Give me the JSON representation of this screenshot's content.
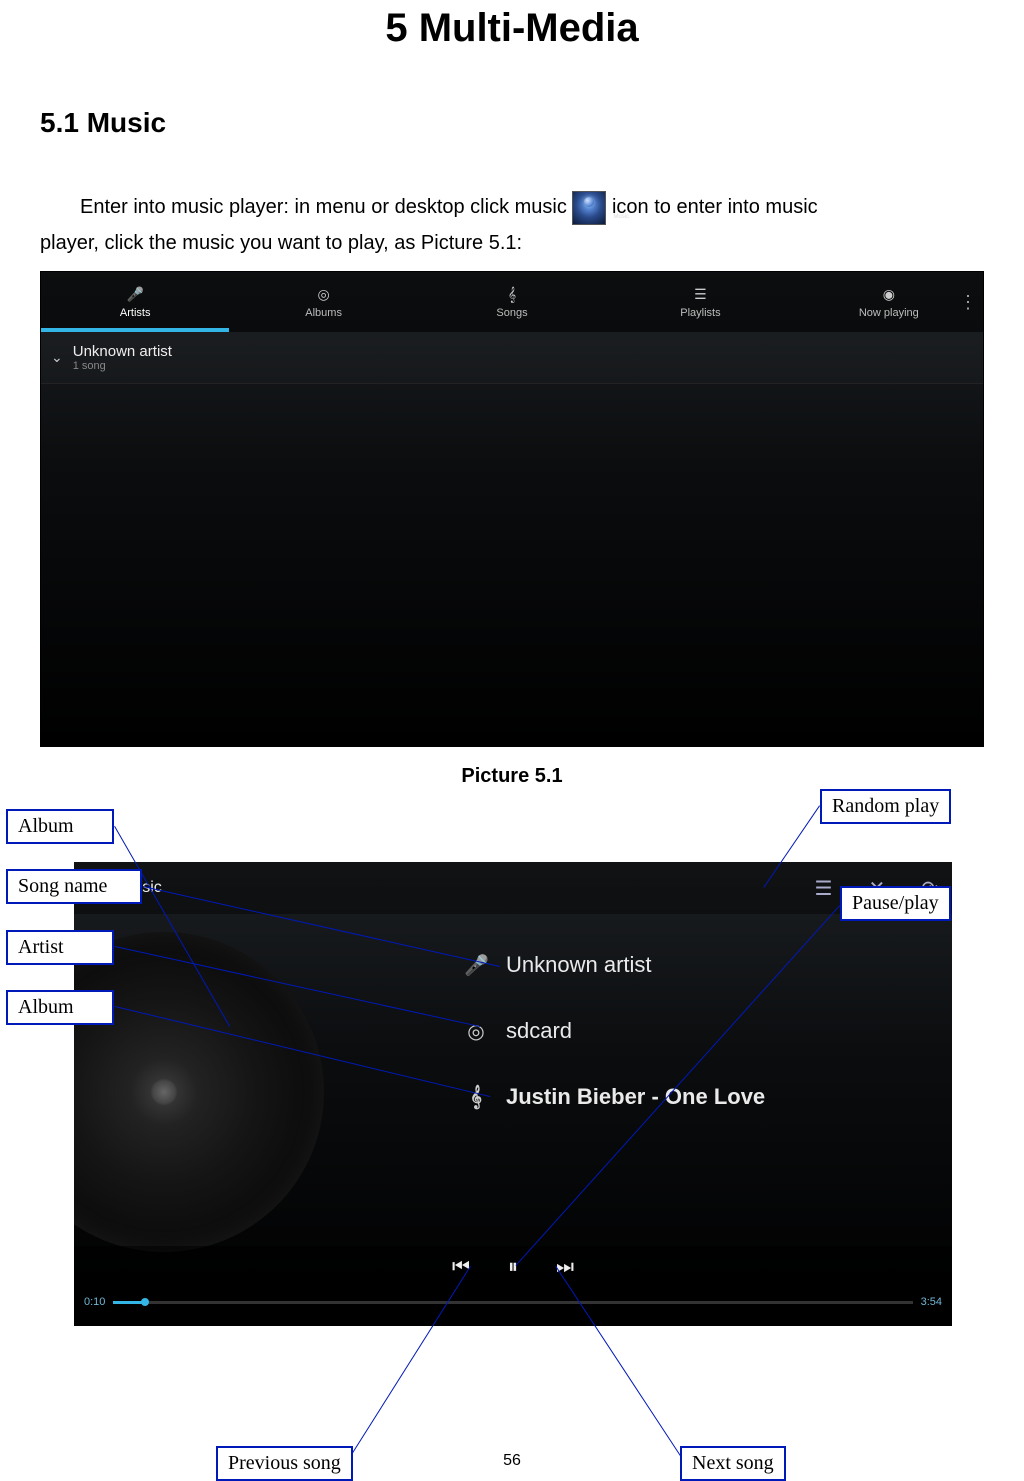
{
  "doc": {
    "chapter_title": "5 Multi-Media",
    "section_title": "5.1 Music",
    "intro_part1": "Enter into music player: in menu or desktop click music ",
    "intro_part2": " icon to enter into music",
    "intro_line2": "player, click the music you want to play, as Picture 5.1:",
    "caption1": "Picture 5.1",
    "page_number": "56"
  },
  "shot1": {
    "tabs": {
      "artists": "Artists",
      "albums": "Albums",
      "songs": "Songs",
      "playlists": "Playlists",
      "now_playing": "Now playing"
    },
    "artist_row": {
      "title": "Unknown artist",
      "subtitle": "1 song"
    }
  },
  "shot2": {
    "top_title": "Music",
    "artist": "Unknown artist",
    "album": "sdcard",
    "song": "Justin Bieber - One Love",
    "time_elapsed": "0:10",
    "time_total": "3:54"
  },
  "callouts": {
    "album_top": "Album",
    "song_name": "Song name",
    "artist": "Artist",
    "album_bottom": "Album",
    "random_play": "Random play",
    "pause_play": "Pause/play",
    "previous_song": "Previous song",
    "next_song": "Next song"
  }
}
